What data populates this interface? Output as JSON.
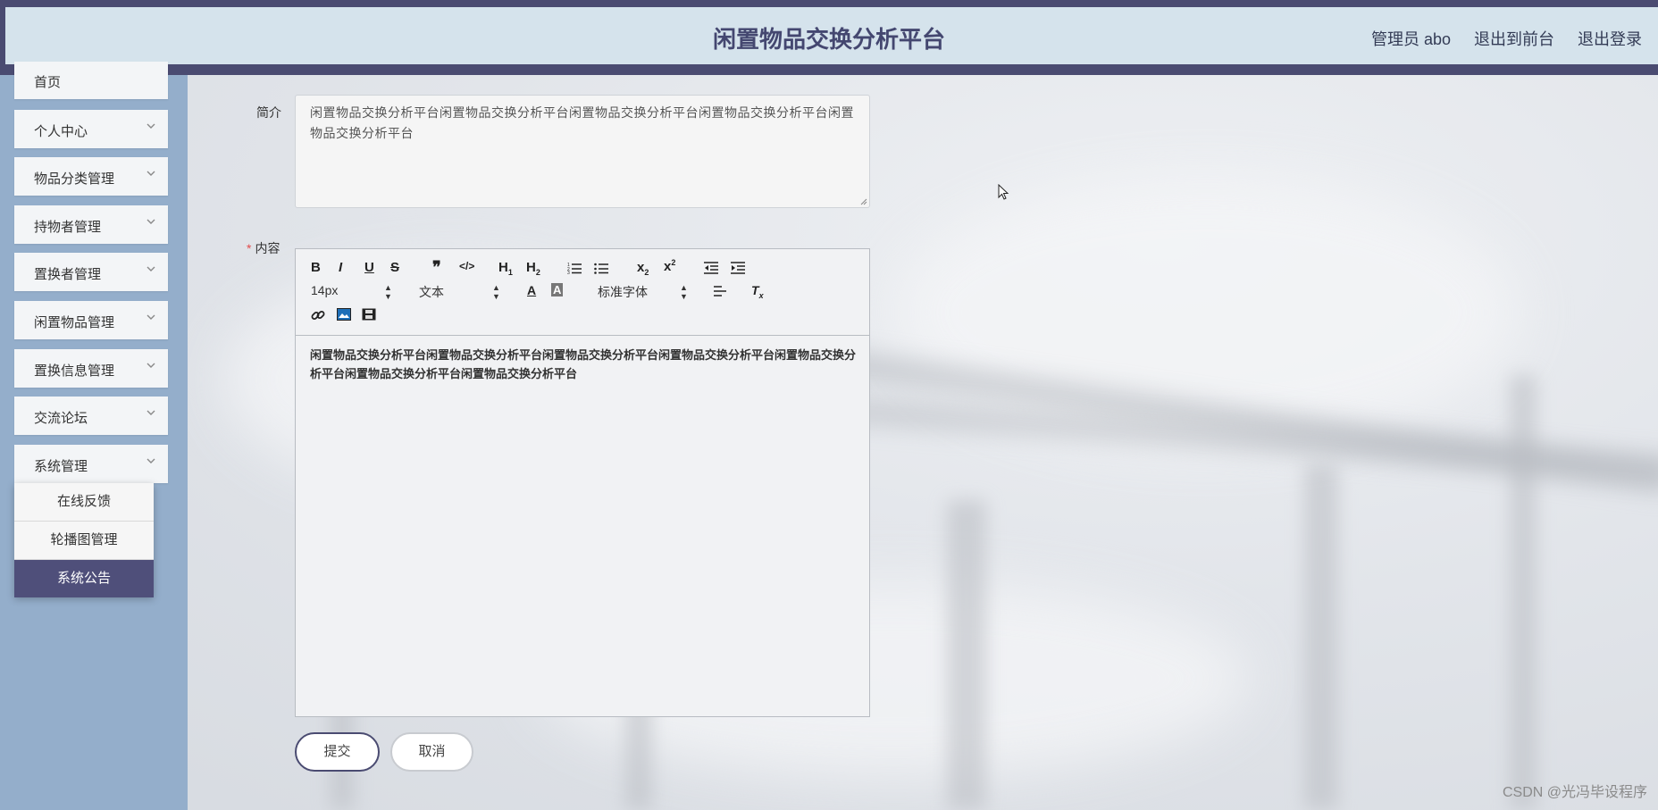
{
  "header": {
    "title": "闲置物品交换分析平台",
    "links": [
      "管理员 abo",
      "退出到前台",
      "退出登录"
    ]
  },
  "sidebar": {
    "items": [
      {
        "label": "首页"
      },
      {
        "label": "个人中心"
      },
      {
        "label": "物品分类管理"
      },
      {
        "label": "持物者管理"
      },
      {
        "label": "置换者管理"
      },
      {
        "label": "闲置物品管理"
      },
      {
        "label": "置换信息管理"
      },
      {
        "label": "交流论坛"
      },
      {
        "label": "系统管理"
      }
    ],
    "submenu": [
      {
        "label": "在线反馈",
        "active": false
      },
      {
        "label": "轮播图管理",
        "active": false
      },
      {
        "label": "系统公告",
        "active": true
      }
    ]
  },
  "form": {
    "intro_label": "简介",
    "intro_value": "闲置物品交换分析平台闲置物品交换分析平台闲置物品交换分析平台闲置物品交换分析平台闲置物品交换分析平台",
    "content_label": "内容",
    "content_required": "*",
    "editor": {
      "font_size": "14px",
      "block_format": "文本",
      "font_family": "标准字体",
      "content": "闲置物品交换分析平台闲置物品交换分析平台闲置物品交换分析平台闲置物品交换分析平台闲置物品交换分析平台闲置物品交换分析平台闲置物品交换分析平台"
    },
    "submit_label": "提交",
    "cancel_label": "取消"
  },
  "watermark": "CSDN @光冯毕设程序",
  "colors": {
    "header_bar": "#4a4b71",
    "header_bg": "#d5e3ec",
    "sidebar_bg": "#94aecb",
    "active_submenu": "#4f4f7a"
  }
}
